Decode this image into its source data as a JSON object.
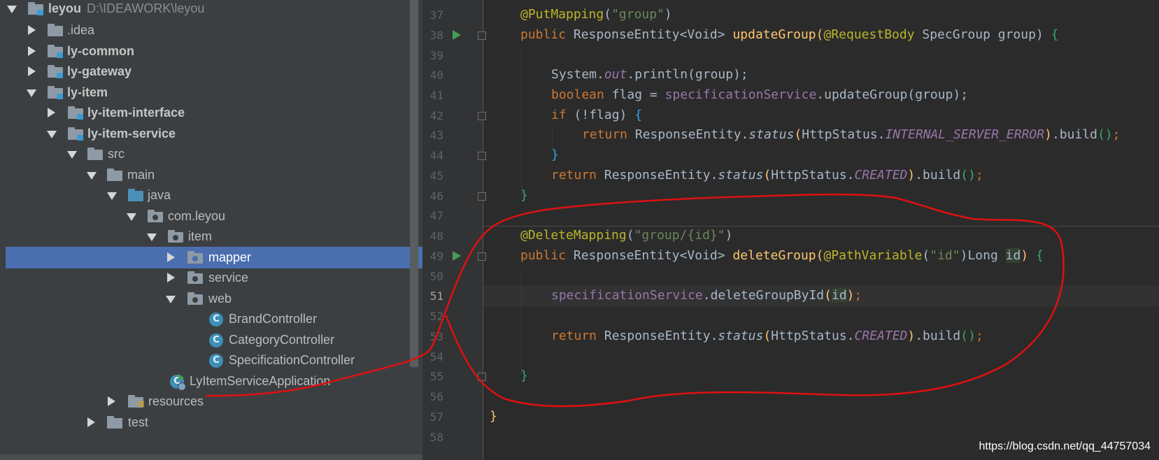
{
  "project_tree": {
    "root": {
      "name": "leyou",
      "path": "D:\\IDEAWORK\\leyou"
    },
    "items": [
      {
        "label": "leyou",
        "depth": 0,
        "expanded": true,
        "type": "module",
        "bold": true
      },
      {
        "label": ".idea",
        "depth": 1,
        "expanded": false,
        "type": "folder"
      },
      {
        "label": "ly-common",
        "depth": 1,
        "expanded": false,
        "type": "module",
        "bold": true
      },
      {
        "label": "ly-gateway",
        "depth": 1,
        "expanded": false,
        "type": "module",
        "bold": true
      },
      {
        "label": "ly-item",
        "depth": 1,
        "expanded": true,
        "type": "module",
        "bold": true
      },
      {
        "label": "ly-item-interface",
        "depth": 2,
        "expanded": false,
        "type": "module",
        "bold": true
      },
      {
        "label": "ly-item-service",
        "depth": 2,
        "expanded": true,
        "type": "module",
        "bold": true
      },
      {
        "label": "src",
        "depth": 3,
        "expanded": true,
        "type": "folder"
      },
      {
        "label": "main",
        "depth": 4,
        "expanded": true,
        "type": "folder"
      },
      {
        "label": "java",
        "depth": 5,
        "expanded": true,
        "type": "source-folder"
      },
      {
        "label": "com.leyou",
        "depth": 6,
        "expanded": true,
        "type": "package"
      },
      {
        "label": "item",
        "depth": 7,
        "expanded": true,
        "type": "package"
      },
      {
        "label": "mapper",
        "depth": 8,
        "expanded": false,
        "type": "package",
        "selected": true
      },
      {
        "label": "service",
        "depth": 8,
        "expanded": false,
        "type": "package"
      },
      {
        "label": "web",
        "depth": 8,
        "expanded": true,
        "type": "package"
      },
      {
        "label": "BrandController",
        "depth": 9,
        "type": "class"
      },
      {
        "label": "CategoryController",
        "depth": 9,
        "type": "class"
      },
      {
        "label": "SpecificationController",
        "depth": 9,
        "type": "class"
      },
      {
        "label": "LyItemServiceApplication",
        "depth": 8,
        "type": "spring-class"
      },
      {
        "label": "resources",
        "depth": 5,
        "expanded": false,
        "type": "resources-folder"
      },
      {
        "label": "test",
        "depth": 4,
        "expanded": false,
        "type": "folder"
      }
    ]
  },
  "editor": {
    "current_line": 51,
    "line_numbers": [
      "37",
      "38",
      "39",
      "40",
      "41",
      "42",
      "43",
      "44",
      "45",
      "46",
      "47",
      "48",
      "49",
      "50",
      "51",
      "52",
      "53",
      "54",
      "55",
      "56",
      "57",
      "58"
    ],
    "code_lines": {
      "l37": {
        "ann": "@PutMapping",
        "p1": "(",
        "str": "\"group\"",
        "p2": ")"
      },
      "l38": {
        "mod": "public ",
        "t1": "ResponseEntity<Void> ",
        "fn": "updateGroup",
        "p1": "(",
        "ann": "@RequestBody",
        "t2": " SpecGroup group) ",
        "br": "{"
      },
      "l40": {
        "t1": "System.",
        "fld": "out",
        "t2": ".println(group);"
      },
      "l41": {
        "kw": "boolean",
        "t1": " flag = ",
        "fld": "specificationService",
        "t2": ".updateGroup(group);"
      },
      "l42": {
        "kw": "if",
        "t1": " (!flag) ",
        "br": "{"
      },
      "l43": {
        "kw": "return",
        "t1": " ResponseEntity.",
        "m": "status",
        "p1": "(",
        "t2": "HttpStatus.",
        "cst": "INTERNAL_SERVER_ERROR",
        "p2": ")",
        "t3": ".build",
        "p3": "()",
        "sc": ";"
      },
      "l44": {
        "br": "}"
      },
      "l45": {
        "kw": "return",
        "t1": " ResponseEntity.",
        "m": "status",
        "p1": "(",
        "t2": "HttpStatus.",
        "cst": "CREATED",
        "p2": ")",
        "t3": ".build",
        "p3": "()",
        "sc": ";"
      },
      "l46": {
        "br": "}"
      },
      "l48": {
        "ann": "@DeleteMapping",
        "p1": "(",
        "str": "\"group/{id}\"",
        "p2": ")"
      },
      "l49": {
        "mod": "public ",
        "t1": "ResponseEntity<Void> ",
        "fn": "deleteGroup",
        "p1": "(",
        "ann": "@PathVariable",
        "p2": "(",
        "str": "\"id\"",
        "p3": ")",
        "t2": "Long ",
        "id": "id",
        "p4": ") ",
        "br": "{"
      },
      "l51": {
        "fld": "specificationService",
        "t1": ".deleteGroupById",
        "p1": "(",
        "id": "id",
        "p2": ")",
        "sc": ";"
      },
      "l53": {
        "kw": "return",
        "t1": " ResponseEntity.",
        "m": "status",
        "p1": "(",
        "t2": "HttpStatus.",
        "cst": "CREATED",
        "p2": ")",
        "t3": ".build",
        "p3": "()",
        "sc": ";"
      },
      "l55": {
        "br": "}"
      },
      "l57": {
        "br": "}"
      }
    }
  },
  "watermark": "https://blog.csdn.net/qq_44757034",
  "colors": {
    "annotation_stroke": "#e01010",
    "selection": "#4b6eaf",
    "run_marker": "#499c54"
  }
}
